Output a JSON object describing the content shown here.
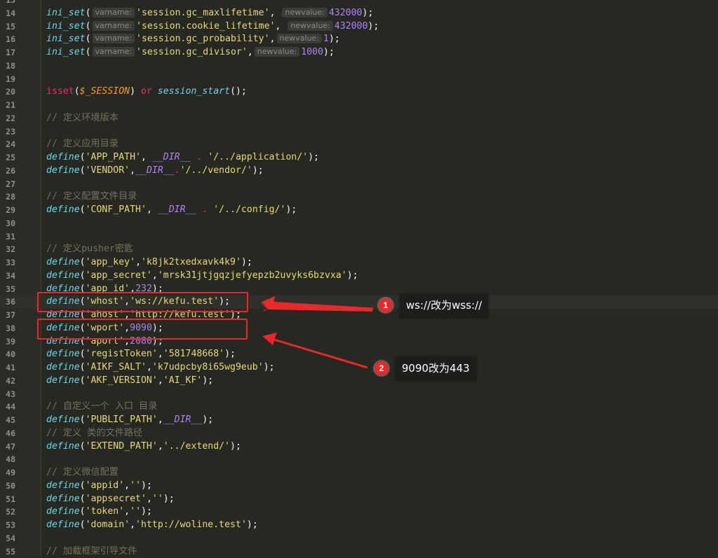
{
  "hints": {
    "varname": "varname:",
    "newvalue": "newvalue:"
  },
  "lines": [
    {
      "n": "13",
      "t": []
    },
    {
      "n": "14",
      "t": [
        [
          "fn",
          "ini_set"
        ],
        [
          "",
          "("
        ],
        [
          "hint",
          "varname:"
        ],
        [
          "str",
          "'session.gc_maxlifetime'"
        ],
        [
          "",
          ", "
        ],
        [
          "hint",
          "newvalue:"
        ],
        [
          "num",
          "432000"
        ],
        [
          "",
          ");"
        ]
      ]
    },
    {
      "n": "15",
      "t": [
        [
          "fn",
          "ini_set"
        ],
        [
          "",
          "("
        ],
        [
          "hint",
          "varname:"
        ],
        [
          "str",
          "'session.cookie_lifetime'"
        ],
        [
          "",
          ", "
        ],
        [
          "hint",
          "newvalue:"
        ],
        [
          "num",
          "432000"
        ],
        [
          "",
          ");"
        ]
      ]
    },
    {
      "n": "16",
      "t": [
        [
          "fn",
          "ini_set"
        ],
        [
          "",
          "("
        ],
        [
          "hint",
          "varname:"
        ],
        [
          "str",
          "'session.gc_probability'"
        ],
        [
          "",
          ","
        ],
        [
          "hint",
          "newvalue:"
        ],
        [
          "num",
          "1"
        ],
        [
          "",
          ");"
        ]
      ]
    },
    {
      "n": "17",
      "t": [
        [
          "fn",
          "ini_set"
        ],
        [
          "",
          "("
        ],
        [
          "hint",
          "varname:"
        ],
        [
          "str",
          "'session.gc_divisor'"
        ],
        [
          "",
          ","
        ],
        [
          "hint",
          "newvalue:"
        ],
        [
          "num",
          "1000"
        ],
        [
          "",
          ");"
        ]
      ]
    },
    {
      "n": "18",
      "t": []
    },
    {
      "n": "19",
      "t": []
    },
    {
      "n": "20",
      "t": [
        [
          "kw",
          "isset"
        ],
        [
          "",
          "("
        ],
        [
          "var",
          "$_SESSION"
        ],
        [
          "",
          ") "
        ],
        [
          "kw",
          "or"
        ],
        [
          "",
          ""
        ],
        [
          "fn",
          " session_start"
        ],
        [
          "",
          "();"
        ]
      ]
    },
    {
      "n": "21",
      "t": []
    },
    {
      "n": "22",
      "t": [
        [
          "cmt",
          "// 定义环境版本"
        ]
      ]
    },
    {
      "n": "23",
      "t": []
    },
    {
      "n": "24",
      "t": [
        [
          "cmt",
          "// 定义应用目录"
        ]
      ]
    },
    {
      "n": "25",
      "t": [
        [
          "fn",
          "define"
        ],
        [
          "",
          "("
        ],
        [
          "str",
          "'APP_PATH'"
        ],
        [
          "",
          ", "
        ],
        [
          "const",
          "__DIR__"
        ],
        [
          "kw",
          " ."
        ],
        [
          "str",
          " '/../application/'"
        ],
        [
          "",
          ");"
        ]
      ]
    },
    {
      "n": "26",
      "t": [
        [
          "fn",
          "define"
        ],
        [
          "",
          "("
        ],
        [
          "str",
          "'VENDOR'"
        ],
        [
          "",
          ","
        ],
        [
          "const",
          "__DIR__"
        ],
        [
          "kw",
          "."
        ],
        [
          "str",
          "'/../vendor/'"
        ],
        [
          "",
          ");"
        ]
      ]
    },
    {
      "n": "27",
      "t": []
    },
    {
      "n": "28",
      "t": [
        [
          "cmt",
          "// 定义配置文件目录"
        ]
      ]
    },
    {
      "n": "29",
      "t": [
        [
          "fn",
          "define"
        ],
        [
          "",
          "("
        ],
        [
          "str",
          "'CONF_PATH'"
        ],
        [
          "",
          ", "
        ],
        [
          "const",
          "__DIR__"
        ],
        [
          "kw",
          " ."
        ],
        [
          "str",
          " '/../config/'"
        ],
        [
          "",
          ");"
        ]
      ]
    },
    {
      "n": "30",
      "t": []
    },
    {
      "n": "31",
      "t": []
    },
    {
      "n": "32",
      "t": [
        [
          "cmt",
          "// 定义pusher密匙"
        ]
      ]
    },
    {
      "n": "33",
      "t": [
        [
          "fn",
          "define"
        ],
        [
          "",
          "("
        ],
        [
          "str",
          "'app_key'"
        ],
        [
          "",
          ","
        ],
        [
          "str",
          "'k8jk2txedxavk4k9'"
        ],
        [
          "",
          ");"
        ]
      ]
    },
    {
      "n": "34",
      "t": [
        [
          "fn",
          "define"
        ],
        [
          "",
          "("
        ],
        [
          "str",
          "'app_secret'"
        ],
        [
          "",
          ","
        ],
        [
          "str",
          "'mrsk31jtjgqzjefyepzb2uvyks6bzvxa'"
        ],
        [
          "",
          ");"
        ]
      ]
    },
    {
      "n": "35",
      "t": [
        [
          "fn",
          "define"
        ],
        [
          "",
          "("
        ],
        [
          "str",
          "'app_id'"
        ],
        [
          "",
          ","
        ],
        [
          "num",
          "232"
        ],
        [
          "",
          ");"
        ]
      ]
    },
    {
      "n": "36",
      "t": [
        [
          "fn",
          "define"
        ],
        [
          "",
          "("
        ],
        [
          "str",
          "'whost'"
        ],
        [
          "",
          ","
        ],
        [
          "str",
          "'ws://kefu.test'"
        ],
        [
          "",
          ");"
        ]
      ]
    },
    {
      "n": "37",
      "t": [
        [
          "fn",
          "define"
        ],
        [
          "",
          "("
        ],
        [
          "str",
          "'ahost'"
        ],
        [
          "",
          ","
        ],
        [
          "str",
          "'http://kefu.test'"
        ],
        [
          "",
          ");"
        ]
      ]
    },
    {
      "n": "38",
      "t": [
        [
          "fn",
          "define"
        ],
        [
          "",
          "("
        ],
        [
          "str",
          "'wport'"
        ],
        [
          "",
          ","
        ],
        [
          "num",
          "9090"
        ],
        [
          "",
          ");"
        ]
      ]
    },
    {
      "n": "39",
      "t": [
        [
          "fn",
          "define"
        ],
        [
          "",
          "("
        ],
        [
          "str",
          "'aport'"
        ],
        [
          "",
          ","
        ],
        [
          "num",
          "2080"
        ],
        [
          "",
          ");"
        ]
      ]
    },
    {
      "n": "40",
      "t": [
        [
          "fn",
          "define"
        ],
        [
          "",
          "("
        ],
        [
          "str",
          "'registToken'"
        ],
        [
          "",
          ","
        ],
        [
          "str",
          "'581748668'"
        ],
        [
          "",
          ");"
        ]
      ]
    },
    {
      "n": "41",
      "t": [
        [
          "fn",
          "define"
        ],
        [
          "",
          "("
        ],
        [
          "str",
          "'AIKF_SALT'"
        ],
        [
          "",
          ","
        ],
        [
          "str",
          "'k7udpcby8i65wg9eub'"
        ],
        [
          "",
          ");"
        ]
      ]
    },
    {
      "n": "42",
      "t": [
        [
          "fn",
          "define"
        ],
        [
          "",
          "("
        ],
        [
          "str",
          "'AKF_VERSION'"
        ],
        [
          "",
          ","
        ],
        [
          "str",
          "'AI_KF'"
        ],
        [
          "",
          ");"
        ]
      ]
    },
    {
      "n": "43",
      "t": []
    },
    {
      "n": "44",
      "t": [
        [
          "cmt",
          "// 自定义一个 入口 目录"
        ]
      ]
    },
    {
      "n": "45",
      "t": [
        [
          "fn",
          "define"
        ],
        [
          "",
          "("
        ],
        [
          "str",
          "'PUBLIC_PATH'"
        ],
        [
          "",
          ","
        ],
        [
          "const",
          "__DIR__"
        ],
        [
          "",
          ");"
        ]
      ]
    },
    {
      "n": "46",
      "t": [
        [
          "cmt",
          "// 定义 类的文件路径"
        ]
      ]
    },
    {
      "n": "47",
      "t": [
        [
          "fn",
          "define"
        ],
        [
          "",
          "("
        ],
        [
          "str",
          "'EXTEND_PATH'"
        ],
        [
          "",
          ","
        ],
        [
          "str",
          "'../extend/'"
        ],
        [
          "",
          ");"
        ]
      ]
    },
    {
      "n": "48",
      "t": []
    },
    {
      "n": "49",
      "t": [
        [
          "cmt",
          "// 定义微信配置"
        ]
      ]
    },
    {
      "n": "50",
      "t": [
        [
          "fn",
          "define"
        ],
        [
          "",
          "("
        ],
        [
          "str",
          "'appid'"
        ],
        [
          "",
          ","
        ],
        [
          "str",
          "''"
        ],
        [
          "",
          ");"
        ]
      ]
    },
    {
      "n": "51",
      "t": [
        [
          "fn",
          "define"
        ],
        [
          "",
          "("
        ],
        [
          "str",
          "'appsecret'"
        ],
        [
          "",
          ","
        ],
        [
          "str",
          "''"
        ],
        [
          "",
          ");"
        ]
      ]
    },
    {
      "n": "52",
      "t": [
        [
          "fn",
          "define"
        ],
        [
          "",
          "("
        ],
        [
          "str",
          "'token'"
        ],
        [
          "",
          ","
        ],
        [
          "str",
          "''"
        ],
        [
          "",
          ");"
        ]
      ]
    },
    {
      "n": "53",
      "t": [
        [
          "fn",
          "define"
        ],
        [
          "",
          "("
        ],
        [
          "str",
          "'domain'"
        ],
        [
          "",
          ","
        ],
        [
          "str",
          "'http://woline.test'"
        ],
        [
          "",
          ");"
        ]
      ]
    },
    {
      "n": "54",
      "t": []
    },
    {
      "n": "55",
      "t": [
        [
          "cmt",
          "// 加载框架引导文件"
        ]
      ]
    }
  ],
  "annotations": [
    {
      "number": "1",
      "text": "ws://改为wss://"
    },
    {
      "number": "2",
      "text": "9090改为443"
    }
  ],
  "colors": {
    "background": "#272822",
    "highlight": "#e8282a"
  }
}
